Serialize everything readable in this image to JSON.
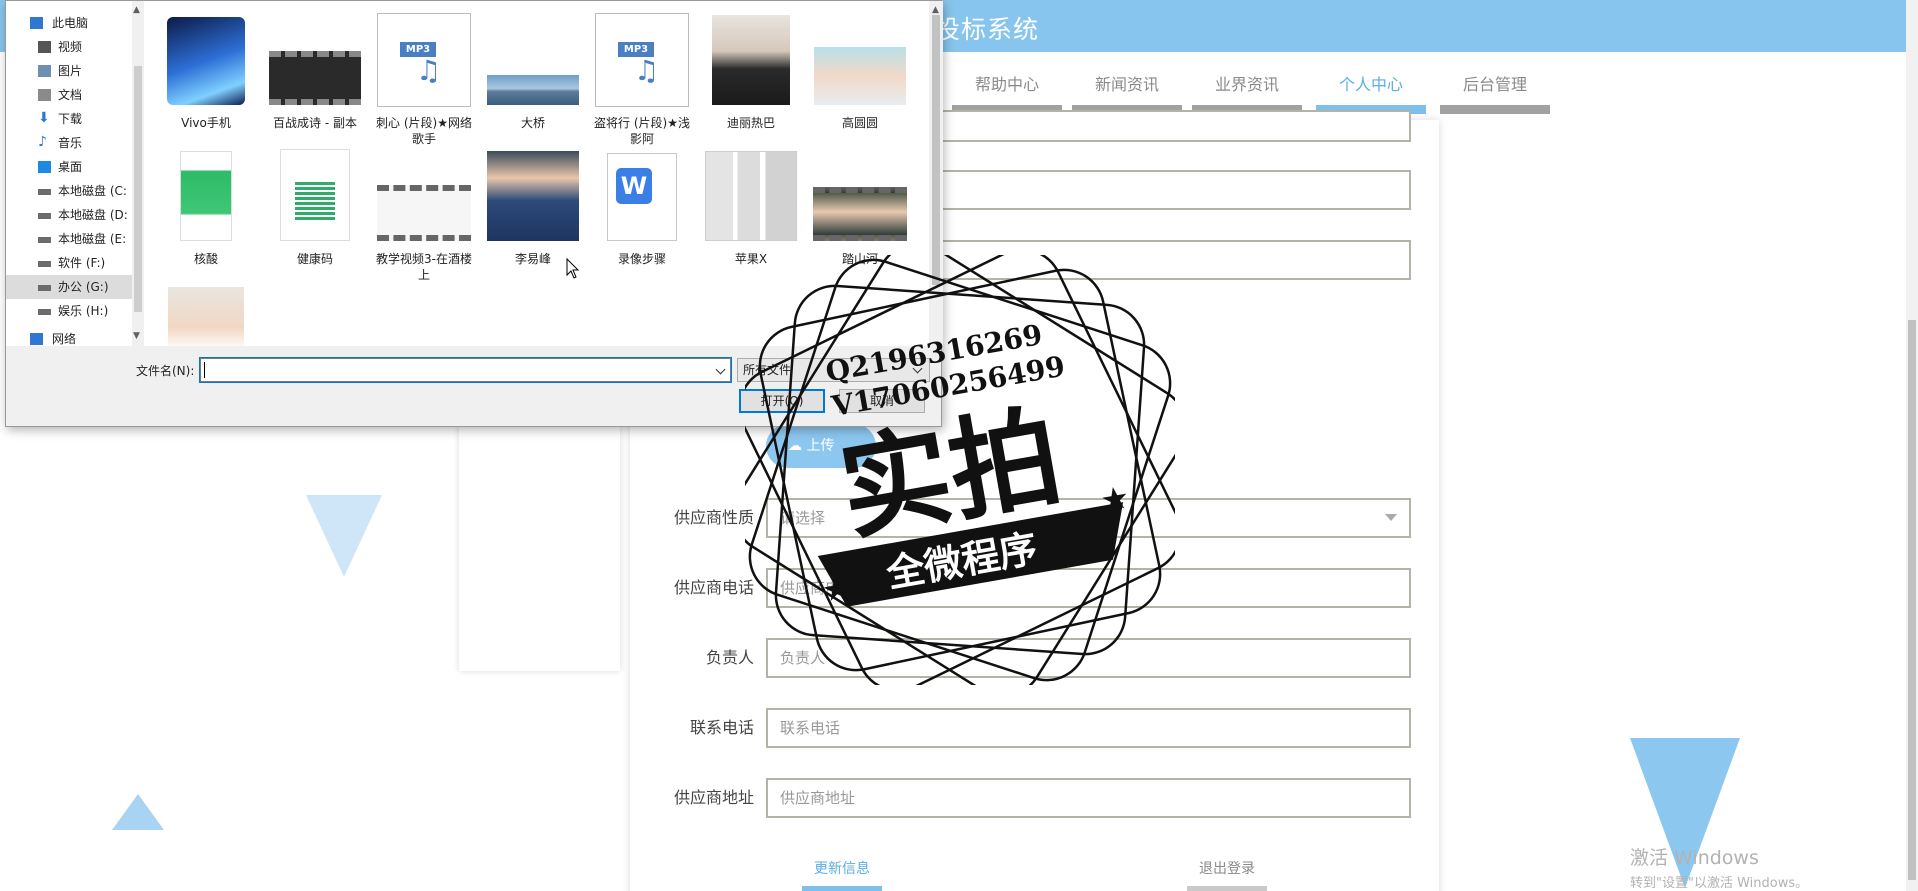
{
  "site": {
    "title": "投标系统",
    "nav": [
      {
        "label": "帮助中心",
        "active": false
      },
      {
        "label": "新闻资讯",
        "active": false
      },
      {
        "label": "业界资讯",
        "active": false
      },
      {
        "label": "个人中心",
        "active": true
      },
      {
        "label": "后台管理",
        "active": false
      }
    ],
    "accent": "#87c5ee"
  },
  "form": {
    "upload_label": "上传",
    "fields": [
      {
        "label": "供应商性质",
        "placeholder": "请选择",
        "type": "select"
      },
      {
        "label": "供应商电话",
        "placeholder": "供应商电话",
        "type": "text"
      },
      {
        "label": "负责人",
        "placeholder": "负责人",
        "type": "text"
      },
      {
        "label": "联系电话",
        "placeholder": "联系电话",
        "type": "text"
      },
      {
        "label": "供应商地址",
        "placeholder": "供应商地址",
        "type": "text"
      }
    ],
    "update_label": "更新信息",
    "logout_label": "退出登录"
  },
  "dialog": {
    "tree": [
      {
        "label": "此电脑",
        "icon": "computer-icon"
      },
      {
        "label": "视频",
        "icon": "video-folder-icon"
      },
      {
        "label": "图片",
        "icon": "pictures-folder-icon"
      },
      {
        "label": "文档",
        "icon": "documents-folder-icon"
      },
      {
        "label": "下载",
        "icon": "download-icon"
      },
      {
        "label": "音乐",
        "icon": "music-icon"
      },
      {
        "label": "桌面",
        "icon": "desktop-icon"
      },
      {
        "label": "本地磁盘 (C:",
        "icon": "drive-icon"
      },
      {
        "label": "本地磁盘 (D:",
        "icon": "drive-icon"
      },
      {
        "label": "本地磁盘 (E:",
        "icon": "drive-icon"
      },
      {
        "label": "软件 (F:)",
        "icon": "drive-icon"
      },
      {
        "label": "办公 (G:)",
        "icon": "drive-icon",
        "selected": true
      },
      {
        "label": "娱乐 (H:)",
        "icon": "drive-icon"
      },
      {
        "label": "网络",
        "icon": "network-icon"
      }
    ],
    "files": [
      {
        "name": "Vivo手机",
        "kind": "phone"
      },
      {
        "name": "百战成诗 - 副本",
        "kind": "video"
      },
      {
        "name": "刺心 (片段)★网络歌手",
        "kind": "mp3"
      },
      {
        "name": "大桥",
        "kind": "bridge"
      },
      {
        "name": "盗将行 (片段)★浅影阿",
        "kind": "mp3"
      },
      {
        "name": "迪丽热巴",
        "kind": "person"
      },
      {
        "name": "高圆圆",
        "kind": "person2"
      },
      {
        "name": "核酸",
        "kind": "green-doc"
      },
      {
        "name": "健康码",
        "kind": "qr-doc"
      },
      {
        "name": "教学视频3-在酒楼上",
        "kind": "teach-video"
      },
      {
        "name": "李易峰",
        "kind": "suit"
      },
      {
        "name": "录像步骤",
        "kind": "wps-doc"
      },
      {
        "name": "苹果X",
        "kind": "iphone"
      },
      {
        "name": "踏山河",
        "kind": "boy-video"
      },
      {
        "name": "",
        "kind": "young"
      }
    ],
    "filename_label": "文件名(N):",
    "filename_value": "",
    "filetype_value": "所有文件",
    "open_label": "打开(O)",
    "cancel_label": "取消"
  },
  "stamp": {
    "line1": "Q2196316269",
    "line2": "V17060256499",
    "main": "实拍",
    "banner": "全微程序"
  },
  "os_watermark": {
    "title": "激活 Windows",
    "subtitle": "转到\"设置\"以激活 Windows。"
  }
}
